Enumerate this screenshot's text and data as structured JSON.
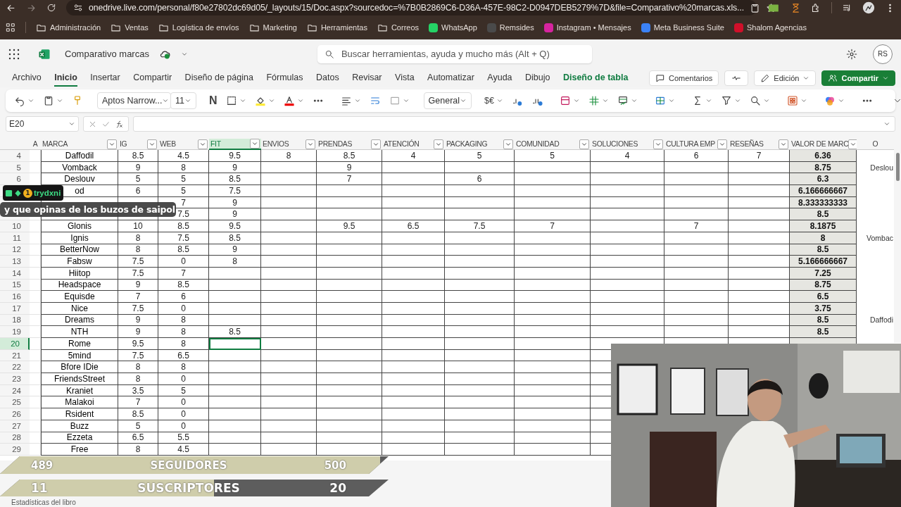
{
  "browser": {
    "url": "onedrive.live.com/personal/f80e27802dc69d05/_layouts/15/Doc.aspx?sourcedoc=%7B0B2869C6-D36A-457E-98C2-D0947DEB5279%7D&file=Comparativo%20marcas.xls...",
    "bookmarks": [
      {
        "label": "Administración",
        "kind": "folder"
      },
      {
        "label": "Ventas",
        "kind": "folder"
      },
      {
        "label": "Logística de envíos",
        "kind": "folder"
      },
      {
        "label": "Marketing",
        "kind": "folder"
      },
      {
        "label": "Herramientas",
        "kind": "folder"
      },
      {
        "label": "Correos",
        "kind": "folder"
      },
      {
        "label": "WhatsApp",
        "kind": "site",
        "color": "#25d366"
      },
      {
        "label": "Remsides",
        "kind": "site",
        "color": "#4a4a4a"
      },
      {
        "label": "Instagram • Mensajes",
        "kind": "site",
        "color": "#d6249f"
      },
      {
        "label": "Meta Business Suite",
        "kind": "site",
        "color": "#3b82f6"
      },
      {
        "label": "Shalom Agencias",
        "kind": "site",
        "color": "#d0102a"
      }
    ]
  },
  "app": {
    "file_name": "Comparativo marcas",
    "search_placeholder": "Buscar herramientas, ayuda y mucho más (Alt + Q)",
    "avatar": "RS"
  },
  "ribbon": {
    "tabs": [
      {
        "label": "Archivo",
        "selected": false,
        "kind": "normal"
      },
      {
        "label": "Inicio",
        "selected": true,
        "kind": "normal"
      },
      {
        "label": "Insertar",
        "selected": false,
        "kind": "normal"
      },
      {
        "label": "Compartir",
        "selected": false,
        "kind": "normal"
      },
      {
        "label": "Diseño de página",
        "selected": false,
        "kind": "normal"
      },
      {
        "label": "Fórmulas",
        "selected": false,
        "kind": "normal"
      },
      {
        "label": "Datos",
        "selected": false,
        "kind": "normal"
      },
      {
        "label": "Revisar",
        "selected": false,
        "kind": "normal"
      },
      {
        "label": "Vista",
        "selected": false,
        "kind": "normal"
      },
      {
        "label": "Automatizar",
        "selected": false,
        "kind": "normal"
      },
      {
        "label": "Ayuda",
        "selected": false,
        "kind": "normal"
      },
      {
        "label": "Dibujo",
        "selected": false,
        "kind": "normal"
      },
      {
        "label": "Diseño de tabla",
        "selected": false,
        "kind": "contextual"
      }
    ],
    "comments": "Comentarios",
    "mode": "Edición",
    "share": "Compartir"
  },
  "toolbar": {
    "font": "Aptos Narrow...",
    "size": "11",
    "bold": "N",
    "number_format": "General",
    "currency": "$€"
  },
  "formula_bar": {
    "name_box": "E20"
  },
  "sheet": {
    "columns": [
      {
        "label": "A",
        "filter": false,
        "selected": false
      },
      {
        "label": "MARCA",
        "filter": true,
        "selected": false
      },
      {
        "label": "IG",
        "filter": true,
        "selected": false
      },
      {
        "label": "WEB",
        "filter": true,
        "selected": false
      },
      {
        "label": "FIT",
        "filter": true,
        "selected": true
      },
      {
        "label": "ENVIOS",
        "filter": true,
        "selected": false
      },
      {
        "label": "PRENDAS",
        "filter": true,
        "selected": false
      },
      {
        "label": "ATENCIÓN",
        "filter": true,
        "selected": false
      },
      {
        "label": "PACKAGING",
        "filter": true,
        "selected": false
      },
      {
        "label": "COMUNIDAD",
        "filter": true,
        "selected": false
      },
      {
        "label": "SOLUCIONES",
        "filter": true,
        "selected": false
      },
      {
        "label": "CULTURA EMP",
        "filter": true,
        "selected": false
      },
      {
        "label": "RESEÑAS",
        "filter": true,
        "selected": false
      },
      {
        "label": "VALOR DE MARC",
        "filter": true,
        "selected": false
      },
      {
        "label": "O",
        "filter": false,
        "selected": false
      }
    ],
    "rows": [
      {
        "number": "4",
        "selected": false,
        "cells": [
          null,
          "Daffodil",
          "8.5",
          "4.5",
          "9.5",
          "8",
          "8.5",
          "4",
          "5",
          "5",
          "4",
          "6",
          "7",
          "6.36",
          null
        ]
      },
      {
        "number": "5",
        "selected": false,
        "cells": [
          null,
          "Vomback",
          "9",
          "8",
          "9",
          null,
          "9",
          null,
          null,
          null,
          null,
          null,
          null,
          "8.75",
          "Deslou"
        ]
      },
      {
        "number": "6",
        "selected": false,
        "cells": [
          null,
          "Deslouv",
          "5",
          "5",
          "8.5",
          null,
          "7",
          null,
          "6",
          null,
          null,
          null,
          null,
          "6.3",
          null
        ]
      },
      {
        "selected": false,
        "cells": [
          null,
          "od",
          "6",
          "5",
          "7.5",
          null,
          null,
          null,
          null,
          null,
          null,
          null,
          null,
          "6.166666667",
          null
        ]
      },
      {
        "selected": false,
        "cells": [
          null,
          null,
          null,
          "7",
          "9",
          null,
          null,
          null,
          null,
          null,
          null,
          null,
          null,
          "8.333333333",
          null
        ]
      },
      {
        "selected": false,
        "cells": [
          null,
          null,
          null,
          "7.5",
          "9",
          null,
          null,
          null,
          null,
          null,
          null,
          null,
          null,
          "8.5",
          null
        ]
      },
      {
        "number": "10",
        "selected": false,
        "cells": [
          null,
          "Glonis",
          "10",
          "8.5",
          "9.5",
          null,
          "9.5",
          "6.5",
          "7.5",
          "7",
          null,
          "7",
          null,
          "8.1875",
          null
        ]
      },
      {
        "number": "11",
        "selected": false,
        "cells": [
          null,
          "Ignis",
          "8",
          "7.5",
          "8.5",
          null,
          null,
          null,
          null,
          null,
          null,
          null,
          null,
          "8",
          "Vombac"
        ]
      },
      {
        "number": "12",
        "selected": false,
        "cells": [
          null,
          "BetterNow",
          "8",
          "8.5",
          "9",
          null,
          null,
          null,
          null,
          null,
          null,
          null,
          null,
          "8.5",
          null
        ]
      },
      {
        "number": "13",
        "selected": false,
        "cells": [
          null,
          "Fabsw",
          "7.5",
          "0",
          "8",
          null,
          null,
          null,
          null,
          null,
          null,
          null,
          null,
          "5.166666667",
          null
        ]
      },
      {
        "number": "14",
        "selected": false,
        "cells": [
          null,
          "Hiitop",
          "7.5",
          "7",
          null,
          null,
          null,
          null,
          null,
          null,
          null,
          null,
          null,
          "7.25",
          null
        ]
      },
      {
        "number": "15",
        "selected": false,
        "cells": [
          null,
          "Headspace",
          "9",
          "8.5",
          null,
          null,
          null,
          null,
          null,
          null,
          null,
          null,
          null,
          "8.75",
          null
        ]
      },
      {
        "number": "16",
        "selected": false,
        "cells": [
          null,
          "Equisde",
          "7",
          "6",
          null,
          null,
          null,
          null,
          null,
          null,
          null,
          null,
          null,
          "6.5",
          null
        ]
      },
      {
        "number": "17",
        "selected": false,
        "cells": [
          null,
          "Nice",
          "7.5",
          "0",
          null,
          null,
          null,
          null,
          null,
          null,
          null,
          null,
          null,
          "3.75",
          null
        ]
      },
      {
        "number": "18",
        "selected": false,
        "cells": [
          null,
          "Dreams",
          "9",
          "8",
          null,
          null,
          null,
          null,
          null,
          null,
          null,
          null,
          null,
          "8.5",
          "Daffodi"
        ]
      },
      {
        "number": "19",
        "selected": false,
        "cells": [
          null,
          "NTH",
          "9",
          "8",
          "8.5",
          null,
          null,
          null,
          null,
          null,
          null,
          null,
          null,
          "8.5",
          null
        ]
      },
      {
        "number": "20",
        "selected": true,
        "cells": [
          null,
          "Rome",
          "9.5",
          "8",
          null,
          null,
          null,
          null,
          null,
          null,
          null,
          null,
          null,
          null,
          null
        ]
      },
      {
        "number": "21",
        "selected": false,
        "cells": [
          null,
          "5mind",
          "7.5",
          "6.5",
          null,
          null,
          null,
          null,
          null,
          null,
          null,
          null,
          null,
          null,
          null
        ]
      },
      {
        "number": "22",
        "selected": false,
        "cells": [
          null,
          "Bfore IDie",
          "8",
          "8",
          null,
          null,
          null,
          null,
          null,
          null,
          null,
          null,
          null,
          null,
          null
        ]
      },
      {
        "number": "23",
        "selected": false,
        "cells": [
          null,
          "FriendsStreet",
          "8",
          "0",
          null,
          null,
          null,
          null,
          null,
          null,
          null,
          null,
          null,
          null,
          null
        ]
      },
      {
        "number": "24",
        "selected": false,
        "cells": [
          null,
          "Kraniet",
          "3.5",
          "5",
          null,
          null,
          null,
          null,
          null,
          null,
          null,
          null,
          null,
          null,
          null
        ]
      },
      {
        "number": "25",
        "selected": false,
        "cells": [
          null,
          "Malakoi",
          "7",
          "0",
          null,
          null,
          null,
          null,
          null,
          null,
          null,
          null,
          null,
          null,
          null
        ]
      },
      {
        "number": "26",
        "selected": false,
        "cells": [
          null,
          "Rsident",
          "8.5",
          "0",
          null,
          null,
          null,
          null,
          null,
          null,
          null,
          null,
          null,
          null,
          null
        ]
      },
      {
        "number": "27",
        "selected": false,
        "cells": [
          null,
          "Buzz",
          "5",
          "0",
          null,
          null,
          null,
          null,
          null,
          null,
          null,
          null,
          null,
          null,
          null
        ]
      },
      {
        "number": "28",
        "selected": false,
        "cells": [
          null,
          "Ezzeta",
          "6.5",
          "5.5",
          null,
          null,
          null,
          null,
          null,
          null,
          null,
          null,
          null,
          null,
          null
        ]
      },
      {
        "number": "29",
        "selected": false,
        "cells": [
          null,
          "Free",
          "8",
          "4.5",
          null,
          null,
          null,
          null,
          null,
          null,
          null,
          null,
          null,
          null,
          null
        ]
      }
    ]
  },
  "status": "Estadísticas del libro",
  "chat": {
    "user": "trydxni",
    "badge": "1",
    "message": "y que opinas de los buzos de saipol"
  },
  "goals": [
    {
      "current": "489",
      "label": "SEGUIDORES",
      "target": "500",
      "level": 0.978
    },
    {
      "current": "11",
      "label": "SUSCRIPTORES",
      "target": "20",
      "level": 0.55
    }
  ]
}
